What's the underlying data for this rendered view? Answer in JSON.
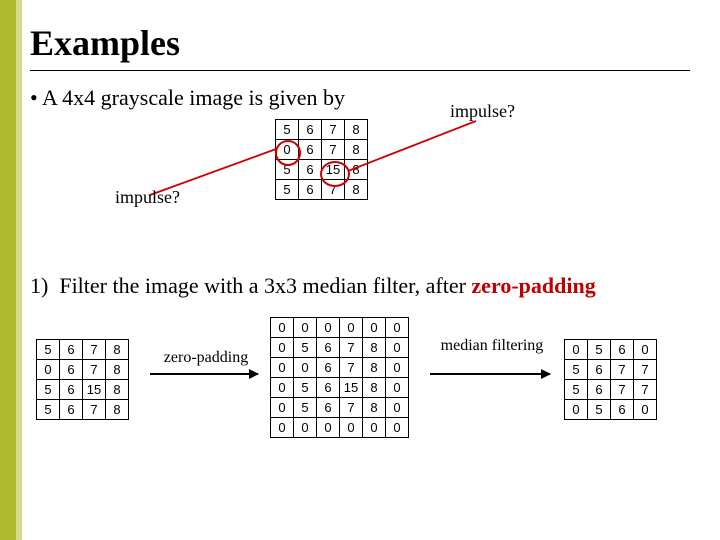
{
  "title": "Examples",
  "bullet": "• A 4x4 grayscale image is given by",
  "impulse_label": "impulse?",
  "matrix_input": [
    [
      "5",
      "6",
      "7",
      "8"
    ],
    [
      "0",
      "6",
      "7",
      "8"
    ],
    [
      "5",
      "6",
      "15",
      "8"
    ],
    [
      "5",
      "6",
      "7",
      "8"
    ]
  ],
  "question": {
    "num": "1)",
    "text_a": "Filter the image with a 3x3 median filter, after ",
    "zp": "zero-padding"
  },
  "matrix_left": [
    [
      "5",
      "6",
      "7",
      "8"
    ],
    [
      "0",
      "6",
      "7",
      "8"
    ],
    [
      "5",
      "6",
      "15",
      "8"
    ],
    [
      "5",
      "6",
      "7",
      "8"
    ]
  ],
  "matrix_padded": [
    [
      "0",
      "0",
      "0",
      "0",
      "0",
      "0"
    ],
    [
      "0",
      "5",
      "6",
      "7",
      "8",
      "0"
    ],
    [
      "0",
      "0",
      "6",
      "7",
      "8",
      "0"
    ],
    [
      "0",
      "5",
      "6",
      "15",
      "8",
      "0"
    ],
    [
      "0",
      "5",
      "6",
      "7",
      "8",
      "0"
    ],
    [
      "0",
      "0",
      "0",
      "0",
      "0",
      "0"
    ]
  ],
  "matrix_result": [
    [
      "0",
      "5",
      "6",
      "0"
    ],
    [
      "5",
      "6",
      "7",
      "7"
    ],
    [
      "5",
      "6",
      "7",
      "7"
    ],
    [
      "0",
      "5",
      "6",
      "0"
    ]
  ],
  "arrow_labels": {
    "zero_padding": "zero-padding",
    "median_filtering": "median filtering"
  }
}
